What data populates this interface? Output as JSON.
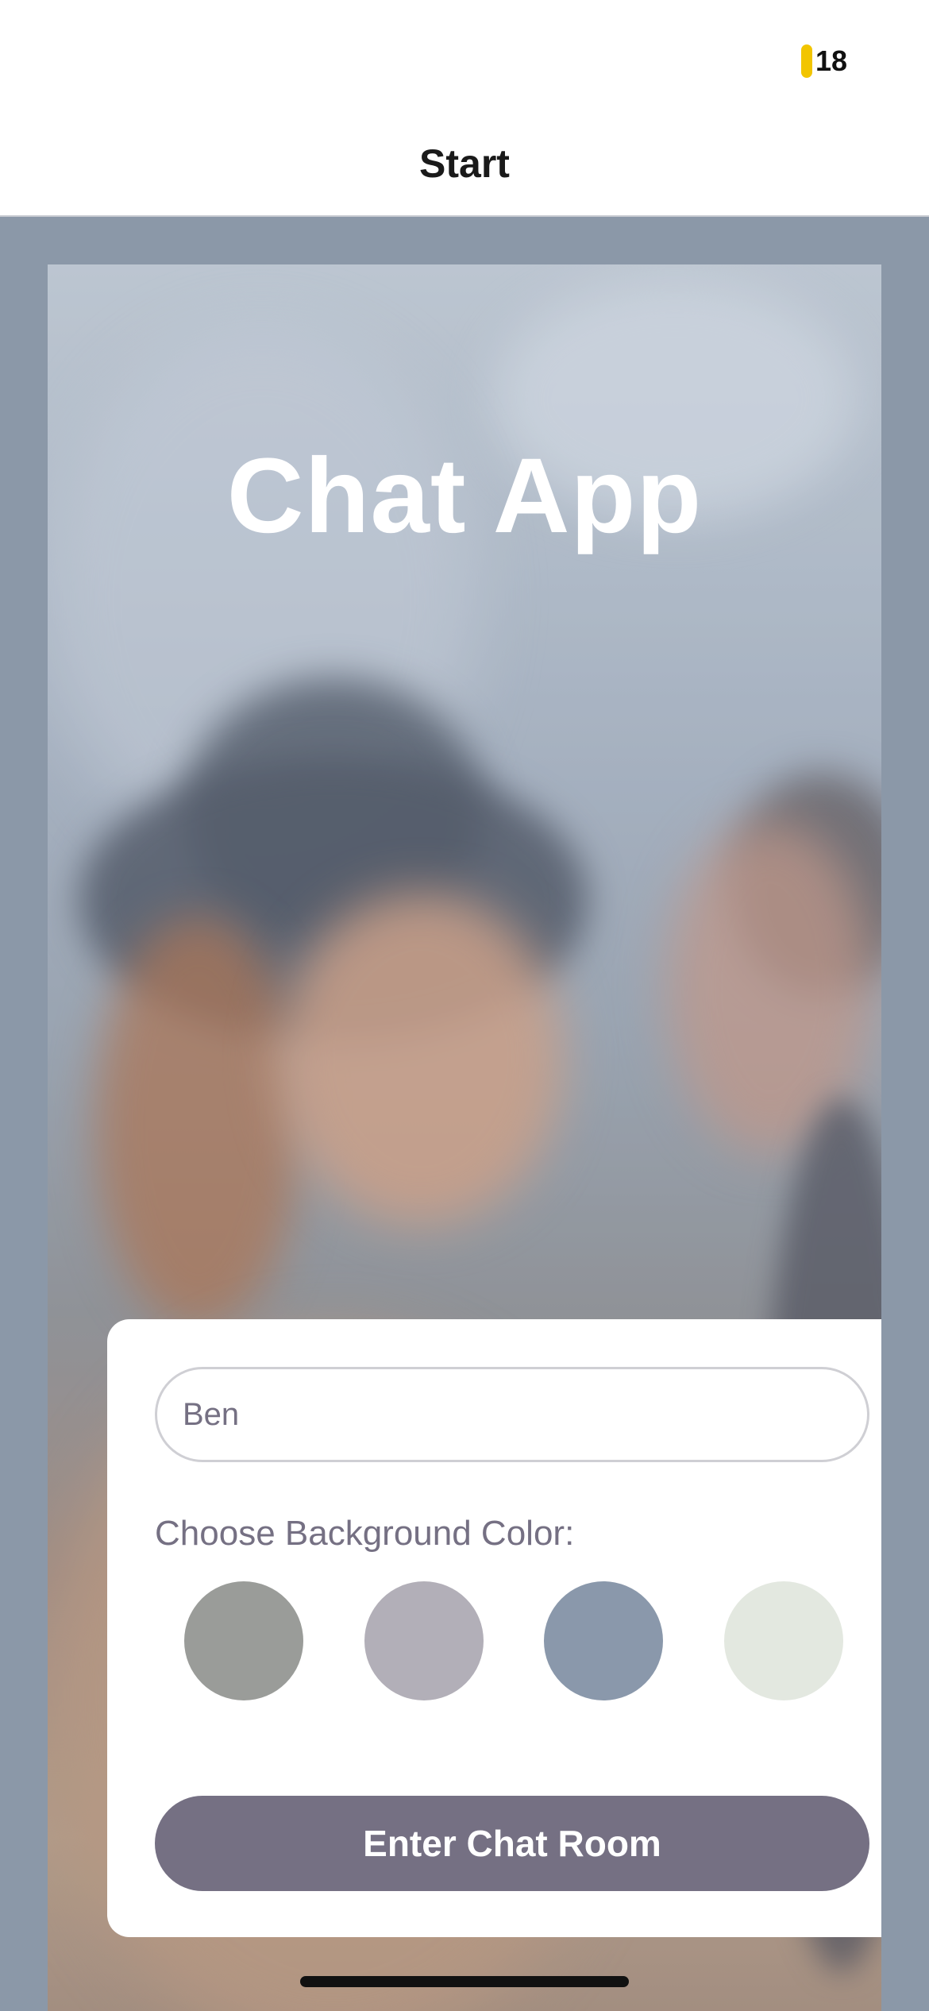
{
  "status_bar": {
    "time": "18",
    "indicator_color": "#f2c500"
  },
  "nav": {
    "title": "Start"
  },
  "hero": {
    "app_title": "Chat App"
  },
  "form": {
    "name_value": "Ben",
    "background_label": "Choose Background Color:",
    "swatches": [
      {
        "color": "#9a9c99"
      },
      {
        "color": "#b2afb8"
      },
      {
        "color": "#8a98ab"
      },
      {
        "color": "#e3e8e0"
      }
    ],
    "enter_button_label": "Enter Chat Room"
  },
  "colors": {
    "accent": "#757083",
    "background": "#8b98a8"
  }
}
